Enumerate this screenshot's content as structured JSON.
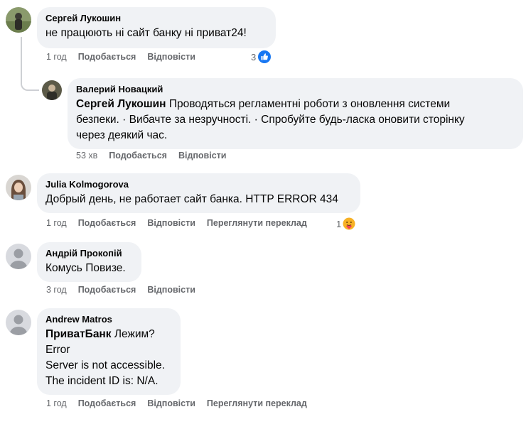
{
  "comments": [
    {
      "author": "Сергей Лукошин",
      "lines": [
        "не працюють ні сайт банку ні приват24!"
      ],
      "time": "1 год",
      "like": "Подобається",
      "reply": "Відповісти",
      "reaction_count": "3",
      "reaction": "like-icon"
    },
    {
      "author": "Валерий Новацкий",
      "mention": "Сергей Лукошин",
      "lines": [
        " Проводяться регламентні роботи з оновлення системи",
        "безпеки. · Вибачте за незручності. · Спробуйте будь-ласка оновити сторінку",
        "через деякий час."
      ],
      "time": "53 хв",
      "like": "Подобається",
      "reply": "Відповісти"
    },
    {
      "author": "Julia Kolmogorova",
      "lines": [
        "Добрый день, не работает сайт банка. HTTP ERROR 434"
      ],
      "time": "1 год",
      "like": "Подобається",
      "reply": "Відповісти",
      "translate": "Переглянути переклад",
      "reaction_count": "1",
      "reaction": "care-icon"
    },
    {
      "author": "Андрій Прокопій",
      "lines": [
        "Комусь Повизе."
      ],
      "time": "3 год",
      "like": "Подобається",
      "reply": "Відповісти"
    },
    {
      "author": "Andrew Matros",
      "mention": "ПриватБанк",
      "lines": [
        " Лежим?",
        "Error",
        "Server is not accessible.",
        "The incident ID is: N/A."
      ],
      "time": "1 год",
      "like": "Подобається",
      "reply": "Відповісти",
      "translate": "Переглянути переклад"
    }
  ],
  "colors": {
    "bubble": "#f0f2f5",
    "meta": "#65676b",
    "like_blue": "#1877f2"
  }
}
